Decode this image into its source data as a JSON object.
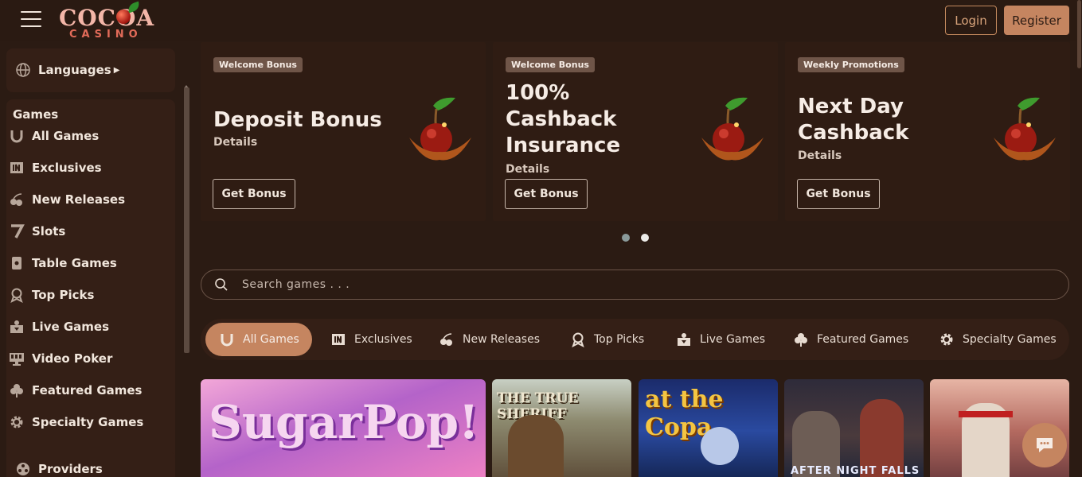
{
  "header": {
    "logo_text": "COCOA",
    "logo_sub": "CASINO",
    "login_label": "Login",
    "register_label": "Register"
  },
  "sidebar": {
    "languages_label": "Languages",
    "games_heading": "Games",
    "items": [
      {
        "label": "All Games",
        "icon": "horseshoe-icon"
      },
      {
        "label": "Exclusives",
        "icon": "exclusive-icon"
      },
      {
        "label": "New Releases",
        "icon": "cherries-icon"
      },
      {
        "label": "Slots",
        "icon": "seven-icon"
      },
      {
        "label": "Table Games",
        "icon": "card-icon"
      },
      {
        "label": "Top Picks",
        "icon": "award-icon"
      },
      {
        "label": "Live Games",
        "icon": "dealer-icon"
      },
      {
        "label": "Video Poker",
        "icon": "monitor-icon"
      },
      {
        "label": "Featured Games",
        "icon": "clover-icon"
      },
      {
        "label": "Specialty Games",
        "icon": "gear-icon"
      }
    ],
    "providers_label": "Providers"
  },
  "promos": [
    {
      "badge": "Welcome Bonus",
      "title_lines": [
        "Deposit Bonus"
      ],
      "details": "Details",
      "button": "Get Bonus"
    },
    {
      "badge": "Welcome Bonus",
      "title_lines": [
        "100%",
        "Cashback",
        "Insurance"
      ],
      "details": "Details",
      "button": "Get Bonus"
    },
    {
      "badge": "Weekly Promotions",
      "title_lines": [
        "Next Day",
        "Cashback"
      ],
      "details": "Details",
      "button": "Get Bonus"
    }
  ],
  "carousel": {
    "active_index": 1,
    "count": 2
  },
  "search": {
    "placeholder": "Search games . . ."
  },
  "tabs": [
    {
      "label": "All Games",
      "active": true
    },
    {
      "label": "Exclusives",
      "active": false
    },
    {
      "label": "New Releases",
      "active": false
    },
    {
      "label": "Top Picks",
      "active": false
    },
    {
      "label": "Live Games",
      "active": false
    },
    {
      "label": "Featured Games",
      "active": false
    },
    {
      "label": "Specialty Games",
      "active": false
    }
  ],
  "games": [
    {
      "title": "SugarPop!"
    },
    {
      "title": "THE TRUE SHERIFF"
    },
    {
      "title": "at the Copa"
    },
    {
      "title": "AFTER NIGHT FALLS"
    },
    {
      "title": ""
    }
  ],
  "colors": {
    "background": "#2b1b13",
    "panel": "#341f16",
    "accent": "#c58560",
    "text": "#f1e6dc"
  }
}
